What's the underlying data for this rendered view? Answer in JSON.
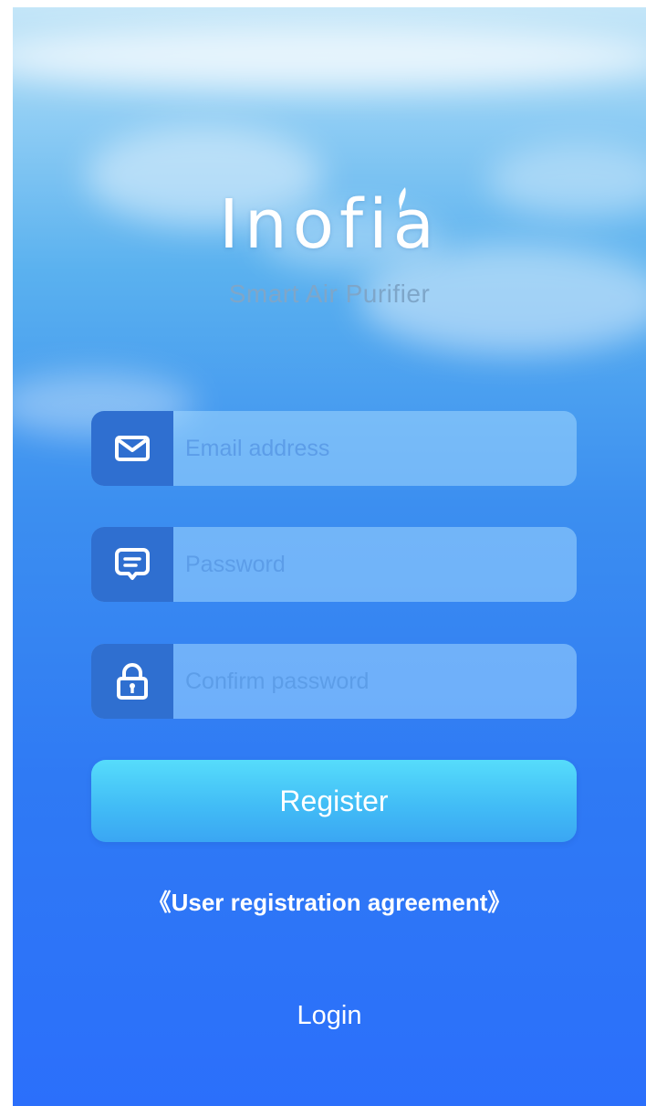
{
  "brand": {
    "logo_text": "Inofia",
    "tagline": "Smart Air Purifier"
  },
  "form": {
    "email": {
      "placeholder": "Email address",
      "value": "",
      "icon": "envelope-icon"
    },
    "password": {
      "placeholder": "Password",
      "value": "",
      "icon": "message-icon"
    },
    "confirm_password": {
      "placeholder": "Confirm password",
      "value": "",
      "icon": "lock-icon"
    }
  },
  "actions": {
    "register_label": "Register",
    "agreement_label": "《User registration agreement》",
    "login_label": "Login"
  },
  "colors": {
    "icon_box": "#2f6fd0",
    "button": "#45c6f7",
    "background_bottom": "#2b6ffb",
    "background_top": "#c4e6f8"
  }
}
